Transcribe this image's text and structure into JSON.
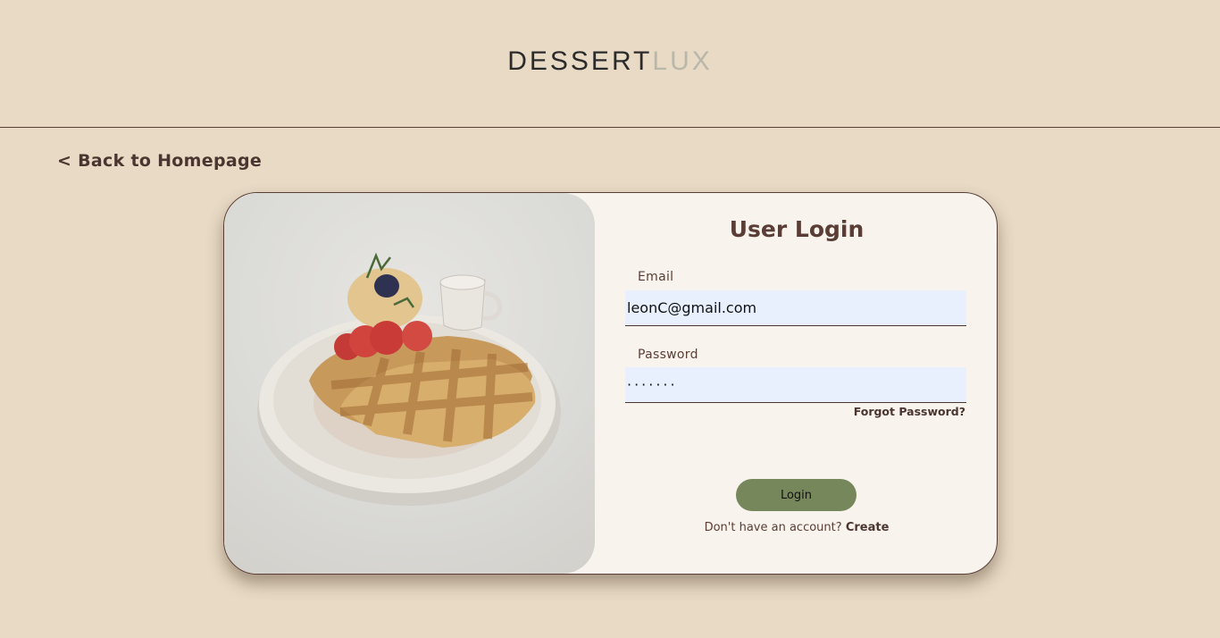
{
  "logo": {
    "dark_text": "DESSERT",
    "light_text": "LUX"
  },
  "nav": {
    "back_label": "< Back to Homepage"
  },
  "login": {
    "title": "User Login",
    "email_label": "Email",
    "email_value": "leonC@gmail.com",
    "password_label": "Password",
    "password_value": "·······",
    "forgot_label": "Forgot Password?",
    "button_label": "Login",
    "signup_prompt": "Don't have an account?",
    "signup_link": "Create"
  },
  "colors": {
    "page_bg": "#e8dac5",
    "card_bg": "#f8f3ec",
    "accent_brown": "#5a3e36",
    "button_green": "#77875c",
    "input_bg": "#e8f0fe"
  }
}
